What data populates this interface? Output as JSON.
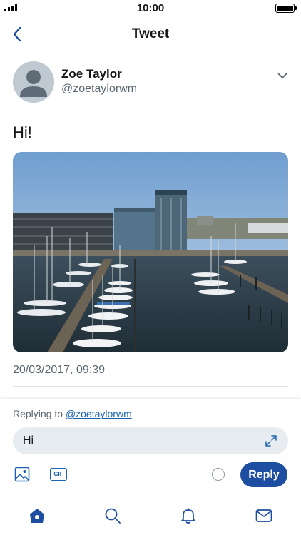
{
  "status_bar": {
    "time": "10:00"
  },
  "header": {
    "title": "Tweet"
  },
  "tweet": {
    "author_name": "Zoe Taylor",
    "author_handle": "@zoetaylorwm",
    "text": "Hi!",
    "timestamp": "20/03/2017, 09:39",
    "photo_description": "harbor marina with sailboats and modern buildings"
  },
  "composer": {
    "replying_prefix": "Replying to",
    "replying_handle": "@zoetaylorwm",
    "input_value": "Hi",
    "gif_label": "GIF",
    "reply_label": "Reply"
  },
  "tab_bar": {
    "items": [
      "home-icon",
      "search-icon",
      "notifications-icon",
      "messages-icon"
    ]
  },
  "colors": {
    "accent": "#1d4ea1",
    "link": "#1b62b3",
    "secondary_text": "#5b6670",
    "input_bg": "#e6ecf0"
  }
}
